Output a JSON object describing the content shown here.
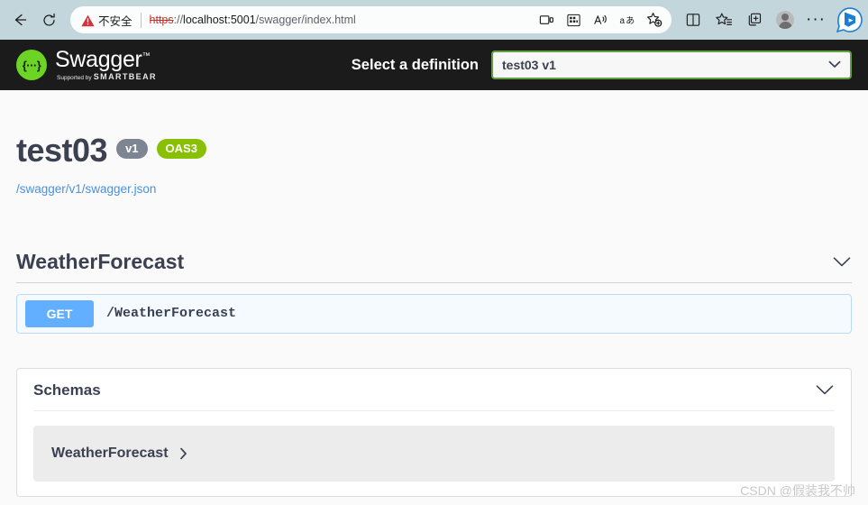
{
  "browser": {
    "back_icon": "back-arrow-icon",
    "refresh_icon": "refresh-icon",
    "security_label": "不安全",
    "url_scheme": "https",
    "url_separator": "://",
    "url_host": "localhost:5001",
    "url_path": "/swagger/index.html",
    "pill_icons": [
      "split-screen-icon",
      "apps-grid-icon",
      "read-aloud-icon",
      "translate-icon",
      "add-favorite-icon"
    ],
    "toolbar_icons": [
      "split-screen-pane-icon",
      "favorites-icon",
      "collections-icon",
      "profile-avatar-icon",
      "settings-ellipsis-icon",
      "copilot-bing-icon"
    ],
    "ellipsis": "···"
  },
  "topbar": {
    "logo_mark_text": "{···}",
    "wordmark": "Swagger",
    "wordmark_tm": "™",
    "byline_prefix": "Supported by",
    "byline_brand": "SMARTBEAR",
    "definition_label": "Select a definition",
    "definition_selected": "test03 v1",
    "definition_options": [
      "test03 v1"
    ],
    "bar_bg": "#1b1b1b",
    "accent_green": "#6bd425",
    "select_border": "#62a03f"
  },
  "info": {
    "title": "test03",
    "version_badge": "v1",
    "oas_badge": "OAS3",
    "definition_link": "/swagger/v1/swagger.json",
    "version_badge_color": "#7d8492",
    "oas_badge_color": "#89bf04",
    "link_color": "#4990e2"
  },
  "operations": {
    "tag_title": "WeatherForecast",
    "tag_collapse_icon": "chevron-down-icon",
    "items": [
      {
        "method": "GET",
        "path": "/WeatherForecast",
        "method_color": "#61affe",
        "block_bg": "#f4faff",
        "block_border": "#bcd9f2"
      }
    ]
  },
  "schemas": {
    "title": "Schemas",
    "collapse_icon": "chevron-down-icon",
    "items": [
      {
        "name": "WeatherForecast",
        "expand_icon": "chevron-right-icon"
      }
    ]
  },
  "watermark": {
    "text": "CSDN @假装我不帅"
  }
}
